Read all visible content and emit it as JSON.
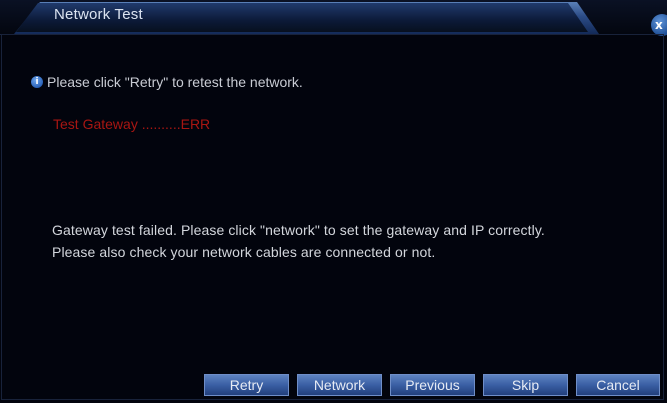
{
  "window": {
    "title": "Network Test",
    "close_glyph": "x"
  },
  "content": {
    "info_text": "Please click \"Retry\" to retest the network.",
    "info_icon_glyph": "i",
    "test_result": "Test Gateway ..........ERR",
    "message_line1": "Gateway test failed. Please click \"network\" to set the gateway and IP correctly.",
    "message_line2": "Please also check your network cables are connected or not."
  },
  "buttons": {
    "retry": "Retry",
    "network": "Network",
    "previous": "Previous",
    "skip": "Skip",
    "cancel": "Cancel"
  },
  "colors": {
    "background": "#02040d",
    "title_tab": "#2c4c86",
    "error_text": "#a81612",
    "button": "#3a5fa4"
  },
  "icons": {
    "info": "info-icon",
    "close": "close-icon"
  }
}
